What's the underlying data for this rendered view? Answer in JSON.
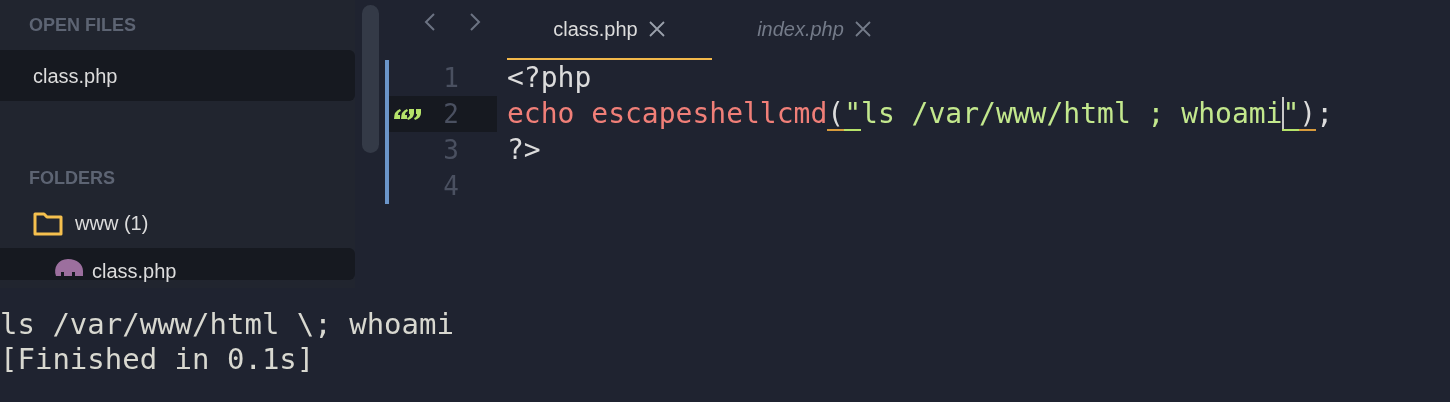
{
  "sidebar": {
    "open_files": {
      "title": "OPEN FILES",
      "items": [
        {
          "label": "class.php",
          "selected": true
        }
      ]
    },
    "folders": {
      "title": "FOLDERS",
      "items": [
        {
          "label": "www (1)",
          "kind": "folder",
          "selected": false
        },
        {
          "label": "class.php",
          "kind": "php",
          "selected": true
        }
      ]
    }
  },
  "tabs": [
    {
      "label": "class.php",
      "selected": true
    },
    {
      "label": "index.php",
      "selected": false
    }
  ],
  "editor": {
    "lines": [
      {
        "number": "1",
        "current": false,
        "marked": false,
        "tokens": [
          {
            "text": "<?php",
            "kind": "plain",
            "matched": false,
            "cursor": false
          }
        ]
      },
      {
        "number": "2",
        "current": true,
        "marked": true,
        "tokens": [
          {
            "text": "echo ",
            "kind": "keyword",
            "matched": false,
            "cursor": false
          },
          {
            "text": "escapeshellcmd",
            "kind": "keyword",
            "matched": false,
            "cursor": false
          },
          {
            "text": "(",
            "kind": "plain",
            "matched": true,
            "cursor": false
          },
          {
            "text": "\"",
            "kind": "string",
            "matched": true,
            "cursor": false
          },
          {
            "text": "ls /var/www/html ; whoami",
            "kind": "string",
            "matched": false,
            "cursor": false
          },
          {
            "text": "\"",
            "kind": "string",
            "matched": true,
            "cursor": true
          },
          {
            "text": ")",
            "kind": "plain",
            "matched": true,
            "cursor": false
          },
          {
            "text": ";",
            "kind": "plain",
            "matched": false,
            "cursor": false
          }
        ]
      },
      {
        "number": "3",
        "current": false,
        "marked": false,
        "tokens": [
          {
            "text": "?>",
            "kind": "plain",
            "matched": false,
            "cursor": false
          }
        ]
      },
      {
        "number": "4",
        "current": false,
        "marked": false
      }
    ]
  },
  "output": {
    "lines": [
      "ls /var/www/html \\; whoami",
      "[Finished in 0.1s]"
    ]
  }
}
